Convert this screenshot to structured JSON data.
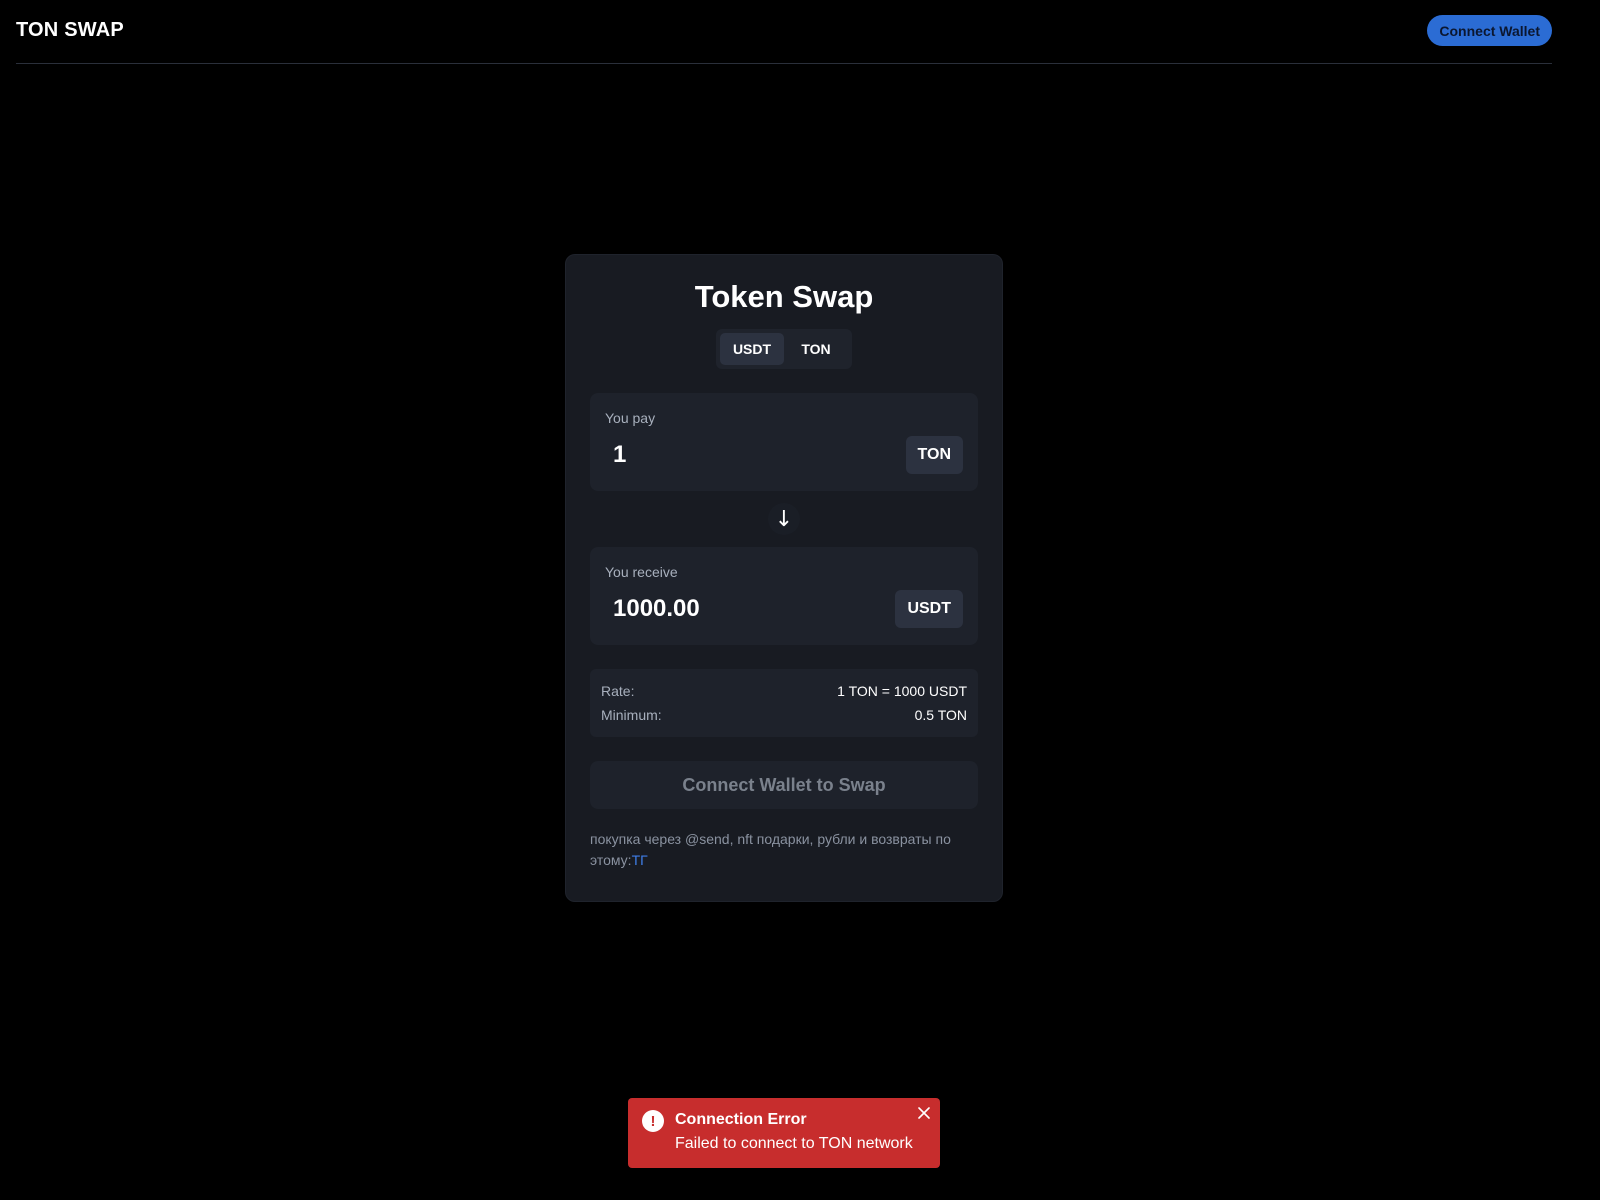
{
  "header": {
    "logo": "TON SWAP",
    "connect_label": "Connect Wallet"
  },
  "card": {
    "title": "Token Swap",
    "tabs": [
      {
        "label": "USDT",
        "active": true
      },
      {
        "label": "TON",
        "active": false
      }
    ],
    "pay": {
      "label": "You pay",
      "value": "1",
      "token": "TON"
    },
    "switch_icon": "arrow-down-icon",
    "receive": {
      "label": "You receive",
      "value": "1000.00",
      "token": "USDT"
    },
    "info": {
      "rate_label": "Rate:",
      "rate_value": "1 TON = 1000 USDT",
      "minimum_label": "Minimum:",
      "minimum_value": "0.5 TON"
    },
    "swap_button": "Connect Wallet to Swap",
    "note_text": "покупка через @send, nft подарки, рубли и возвраты по этому:",
    "note_link": "ТГ"
  },
  "toast": {
    "icon": "exclamation-icon",
    "title": "Connection Error",
    "message": "Failed to connect to TON network",
    "close_icon": "close-icon"
  },
  "colors": {
    "accent": "#2b6cd4",
    "card_bg": "#181b22",
    "panel_bg": "#1e222b",
    "error": "#c72d2d",
    "link": "#3f7ee8"
  }
}
